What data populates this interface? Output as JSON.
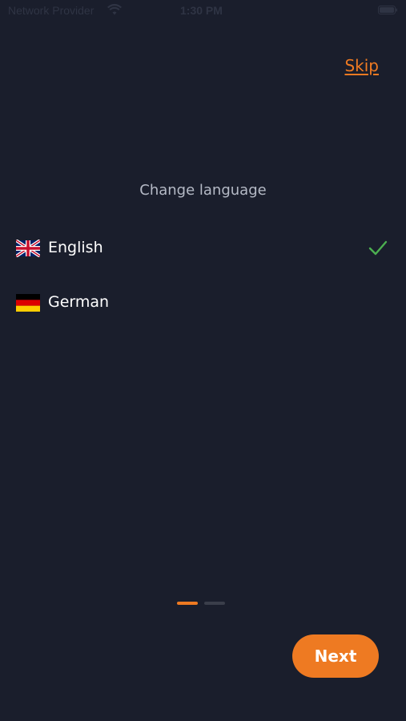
{
  "status_bar": {
    "carrier": "Network Provider",
    "time": "1:30 PM",
    "wifi_icon": "wifi-icon",
    "battery_icon": "battery-icon"
  },
  "header": {
    "skip_label": "Skip"
  },
  "main": {
    "title": "Change language",
    "languages": [
      {
        "label": "English",
        "flag_icon": "uk-flag-icon",
        "selected": true
      },
      {
        "label": "German",
        "flag_icon": "germany-flag-icon",
        "selected": false
      }
    ],
    "selected_check_icon": "check-icon"
  },
  "pager": {
    "current_page": 1,
    "total_pages": 2
  },
  "footer": {
    "next_label": "Next"
  },
  "colors": {
    "background": "#1a1e2c",
    "accent": "#ee7a22",
    "check": "#4caf50",
    "title_text": "#b5bac6"
  }
}
